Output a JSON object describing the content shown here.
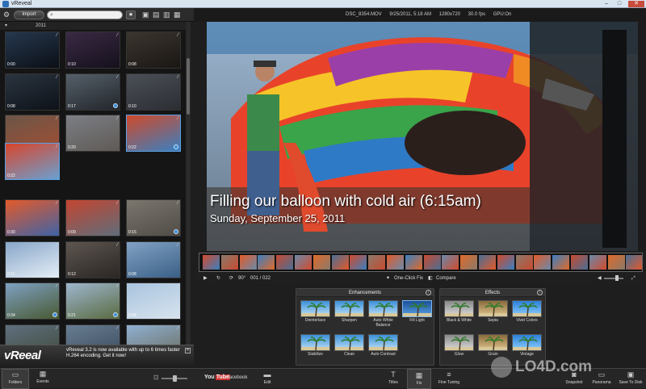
{
  "window": {
    "title": "vReveal"
  },
  "toolbar": {
    "import_label": "Import",
    "search_placeholder": "",
    "star_label": "★"
  },
  "library": {
    "year_label": "2011",
    "thumbnails": [
      {
        "duration": "0:00",
        "badge": "",
        "colors": [
          "#26384e",
          "#0b0f16"
        ]
      },
      {
        "duration": "0:10",
        "badge": "",
        "colors": [
          "#3a2a44",
          "#15101c"
        ]
      },
      {
        "duration": "0:08",
        "badge": "",
        "colors": [
          "#3c3630",
          "#1a1613"
        ]
      },
      {
        "duration": "0:08",
        "badge": "",
        "colors": [
          "#2b3440",
          "#0d1218"
        ]
      },
      {
        "duration": "0:17",
        "badge": "8",
        "colors": [
          "#56606a",
          "#22262b"
        ]
      },
      {
        "duration": "0:10",
        "badge": "",
        "colors": [
          "#4b4f57",
          "#2b2e33"
        ]
      },
      {
        "duration": "0:23",
        "badge": "",
        "colors": [
          "#6a5648",
          "#a24e33"
        ]
      },
      {
        "duration": "0:20",
        "badge": "",
        "colors": [
          "#7c7f86",
          "#5f5a55"
        ]
      },
      {
        "duration": "0:22",
        "badge": "8",
        "colors": [
          "#d04a2a",
          "#3a7fc0"
        ]
      },
      {
        "duration": "0:22",
        "badge": "",
        "colors": [
          "#d9452c",
          "#6aa0d0"
        ]
      },
      {
        "duration": "0:30",
        "badge": "",
        "colors": [
          "#e35a2a",
          "#3f63a7"
        ]
      },
      {
        "duration": "0:09",
        "badge": "",
        "colors": [
          "#c44530",
          "#5f6d7a"
        ]
      },
      {
        "duration": "0:15",
        "badge": "2",
        "colors": [
          "#7b776f",
          "#504c46"
        ]
      },
      {
        "duration": "0:11",
        "badge": "",
        "colors": [
          "#88a6c8",
          "#e5eef7"
        ]
      },
      {
        "duration": "0:12",
        "badge": "",
        "colors": [
          "#5d5550",
          "#2b2724"
        ]
      },
      {
        "duration": "0:08",
        "badge": "",
        "colors": [
          "#81a2c4",
          "#3b5f86"
        ]
      },
      {
        "duration": "0:34",
        "badge": "8",
        "colors": [
          "#7ea0c2",
          "#495a33"
        ]
      },
      {
        "duration": "0:21",
        "badge": "8",
        "colors": [
          "#9eb6cf",
          "#5a6b41"
        ]
      },
      {
        "duration": "0:08",
        "badge": "",
        "colors": [
          "#a9c4de",
          "#d7e3ee"
        ]
      },
      {
        "duration": "",
        "badge": "",
        "colors": [
          "#5f6f7f",
          "#3f4a39"
        ]
      },
      {
        "duration": "",
        "badge": "",
        "colors": [
          "#687d92",
          "#39485a"
        ]
      },
      {
        "duration": "",
        "badge": "",
        "colors": [
          "#8fb0d2",
          "#6a6a5a"
        ]
      }
    ]
  },
  "promo": {
    "logo_prefix": "vRe",
    "logo_suffix": "eal",
    "message": "vReveal 3.2 is now available with up to 6 times faster H.264 encoding. Get it now!"
  },
  "left_nav": {
    "folders": "Folders",
    "events": "Events"
  },
  "info": {
    "filename": "DSC_8354.MOV",
    "datetime": "9/25/2011, 5:18 AM",
    "resolution": "1280x720",
    "fps": "30.0 fps",
    "gpu": "GPU:On"
  },
  "video": {
    "caption_title": "Filling our balloon with cold air (6:15am)",
    "caption_date": "Sunday, September 25, 2011"
  },
  "playback": {
    "speed": "90°",
    "counter": "001 / 022",
    "one_click_fix": "One-Click Fix",
    "compare": "Compare",
    "volume_level": 0.6
  },
  "enhancements": {
    "title": "Enhancements",
    "items": [
      {
        "label": "Deinterlace",
        "on": false
      },
      {
        "label": "Sharpen",
        "on": false
      },
      {
        "label": "Auto White Balance",
        "on": false
      },
      {
        "label": "Fill Light",
        "on": true
      },
      {
        "label": "Stabilize",
        "on": false
      },
      {
        "label": "Clean",
        "on": false
      },
      {
        "label": "Auto Contrast",
        "on": false
      }
    ]
  },
  "effects": {
    "title": "Effects",
    "items": [
      {
        "label": "Black & White",
        "on": false
      },
      {
        "label": "Sepia",
        "on": false
      },
      {
        "label": "Vivid Colors",
        "on": false
      },
      {
        "label": "Glow",
        "on": false
      },
      {
        "label": "Grain",
        "on": false
      },
      {
        "label": "Vintage",
        "on": false
      }
    ]
  },
  "bottom": {
    "youtube": "You",
    "youtube_suffix": "Tube",
    "facebook": "facebook",
    "edit": "Edit",
    "titles": "Titles",
    "fix": "Fix",
    "fine_tuning": "Fine Tuning",
    "snapshot": "Snapshot",
    "panorama": "Panorama",
    "save_to_disk": "Save To Disk"
  },
  "watermark": {
    "text": "LO4D.com"
  },
  "colors": {
    "accent": "#5aa3e6",
    "badge": "#3a8fd8",
    "panel_bg": "#2c2c2c",
    "bg": "#1e1e1e"
  }
}
